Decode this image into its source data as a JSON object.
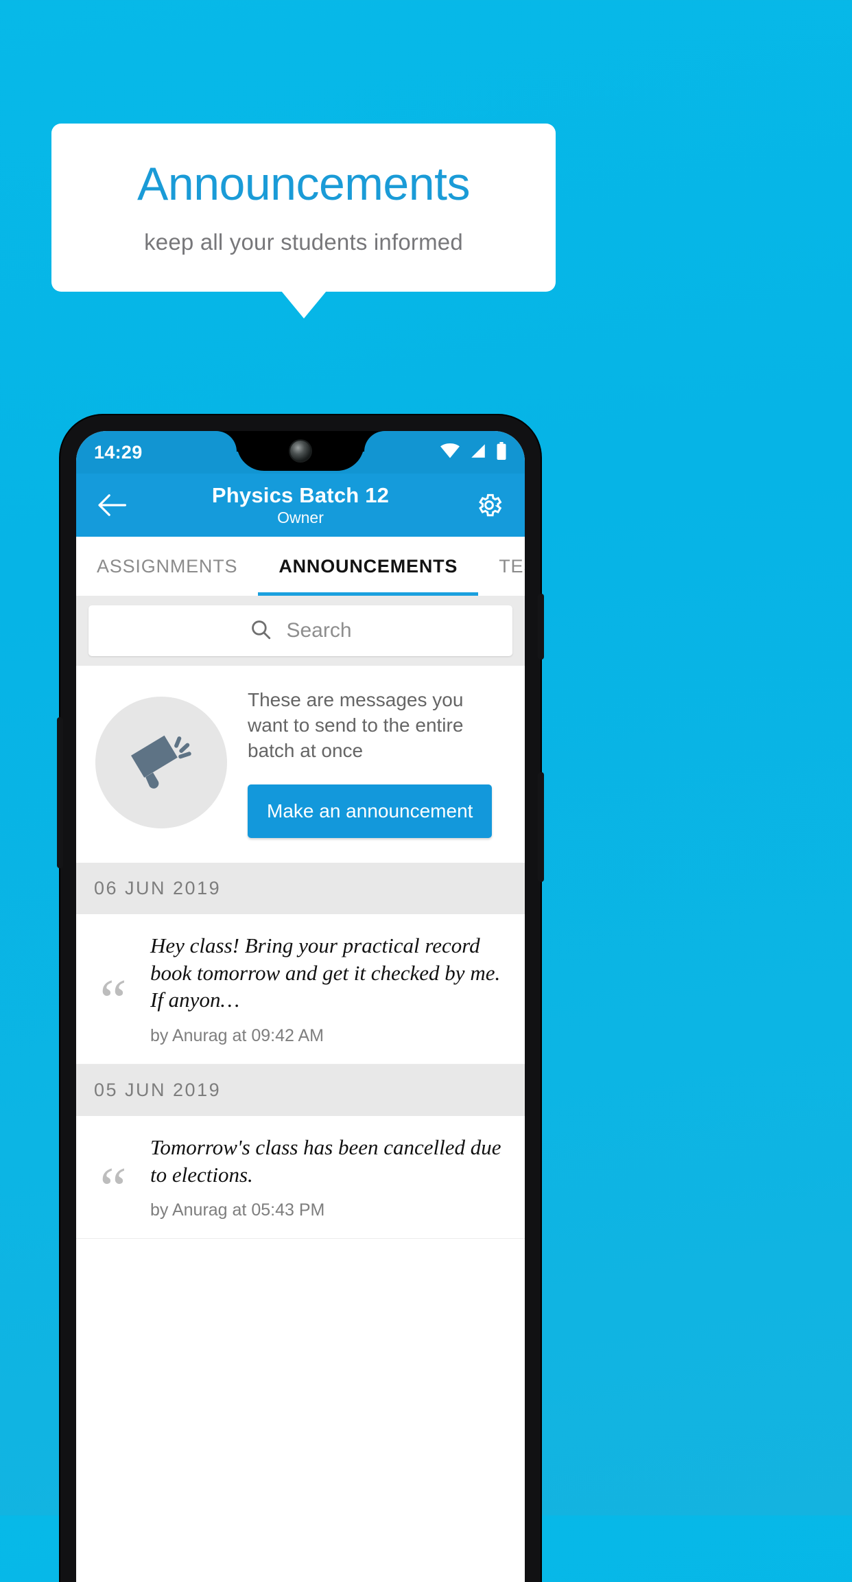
{
  "promo": {
    "title": "Announcements",
    "subtitle": "keep all your students informed",
    "title_color": "#1a9bd7",
    "background_color": "#06b4e6"
  },
  "phone": {
    "status_bar": {
      "time": "14:29",
      "icons": [
        "wifi-icon",
        "signal-icon",
        "battery-icon"
      ]
    },
    "app_bar": {
      "back_icon": "back-arrow-icon",
      "title": "Physics Batch 12",
      "subtitle": "Owner",
      "settings_icon": "gear-icon",
      "color": "#159bdb"
    },
    "tabs": [
      {
        "label": "ASSIGNMENTS",
        "active": false
      },
      {
        "label": "ANNOUNCEMENTS",
        "active": true
      },
      {
        "label": "TESTS",
        "active": false
      },
      {
        "label": "’",
        "active": false
      }
    ],
    "search": {
      "placeholder": "Search",
      "icon": "search-icon"
    },
    "hero": {
      "icon": "megaphone-icon",
      "description": "These are messages you want to send to the entire batch at once",
      "button_label": "Make an announcement",
      "button_color": "#1398db"
    },
    "groups": [
      {
        "date": "06  JUN  2019",
        "items": [
          {
            "text": "Hey class! Bring your practical record book tomorrow and get it checked by me. If anyon…",
            "meta": "by Anurag at 09:42 AM"
          }
        ]
      },
      {
        "date": "05  JUN  2019",
        "items": [
          {
            "text": "Tomorrow's class has been cancelled due to elections.",
            "meta": "by Anurag at 05:43 PM"
          }
        ]
      }
    ]
  }
}
